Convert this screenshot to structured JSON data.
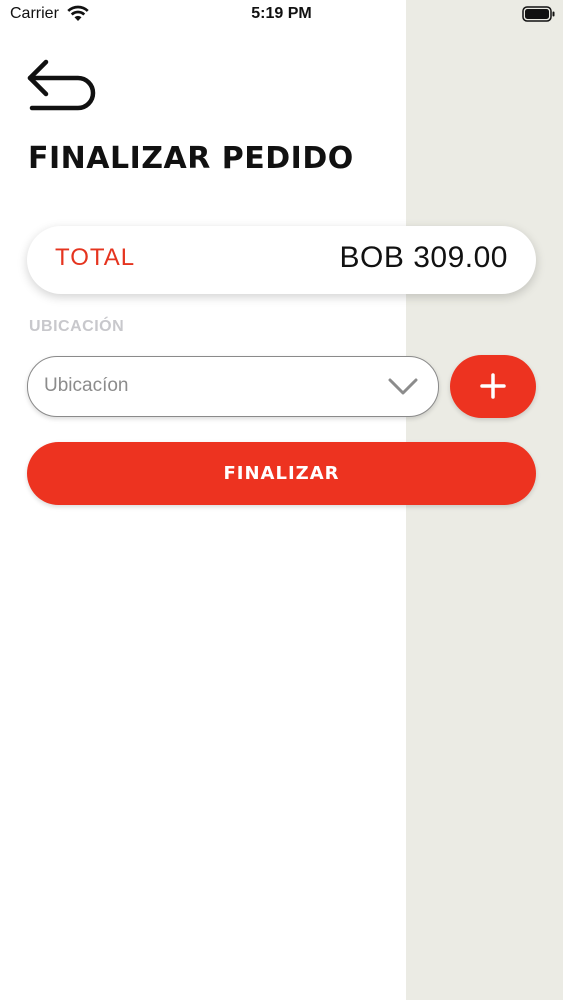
{
  "status_bar": {
    "carrier": "Carrier",
    "time": "5:19 PM"
  },
  "header": {
    "title": "FINALIZAR PEDIDO"
  },
  "total": {
    "label": "TOTAL",
    "value": "BOB 309.00"
  },
  "location": {
    "section_label": "UBICACIÓN",
    "placeholder": "Ubicacíon"
  },
  "actions": {
    "finish_label": "FINALIZAR"
  },
  "icons": {
    "back": "back-arrow-icon",
    "add": "plus-icon",
    "dropdown": "chevron-down-icon",
    "wifi": "wifi-icon",
    "battery": "battery-icon"
  },
  "colors": {
    "accent": "#ed3320",
    "total_label": "#e5341f",
    "side_panel": "#ebebe4",
    "muted_label": "#c8c8cc"
  }
}
